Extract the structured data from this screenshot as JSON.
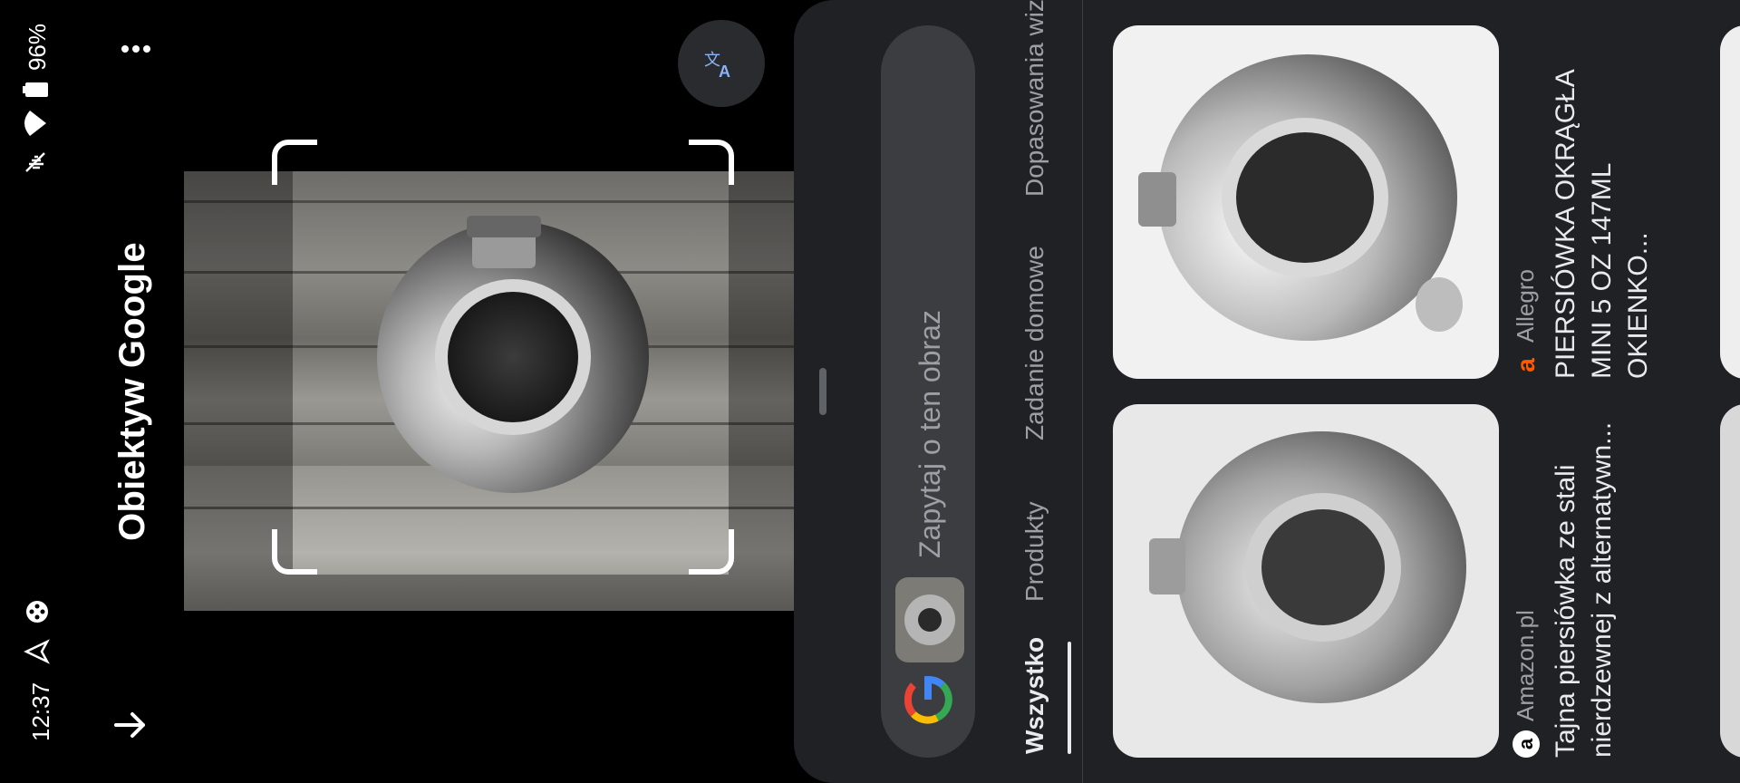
{
  "status_bar": {
    "time": "12:37",
    "battery": "96%",
    "icons": [
      "navigation-icon",
      "game-controller-icon",
      "mute-icon",
      "wifi-icon",
      "battery-icon"
    ]
  },
  "header": {
    "title": "Obiektyw Google",
    "back_icon": "arrow-down-icon",
    "menu_icon": "more-vert-icon",
    "translate_icon": "translate-icon"
  },
  "search": {
    "placeholder": "Zapytaj o ten obraz",
    "logo": "google-g-icon"
  },
  "tabs": [
    {
      "label": "Wszystko",
      "active": true
    },
    {
      "label": "Produkty",
      "active": false
    },
    {
      "label": "Zadanie domowe",
      "active": false
    },
    {
      "label": "Dopasowania wiz",
      "active": false
    }
  ],
  "results": [
    {
      "source": "Amazon.pl",
      "source_icon": "amazon-icon",
      "title": "Tajna piersiówka ze stali nierdzewnej z alternatywn..."
    },
    {
      "source": "Allegro",
      "source_icon": "allegro-icon",
      "title": "PIERSIÓWKA OKRĄGŁA MINI 5 OZ 147ML OKIENKO..."
    }
  ],
  "colors": {
    "background": "#000000",
    "sheet": "#202124",
    "search_box": "#3c3d40",
    "text_primary": "#e8eaed",
    "text_secondary": "#9aa0a6",
    "accent_blue": "#8ab4f8",
    "allegro_orange": "#ff5a00"
  }
}
